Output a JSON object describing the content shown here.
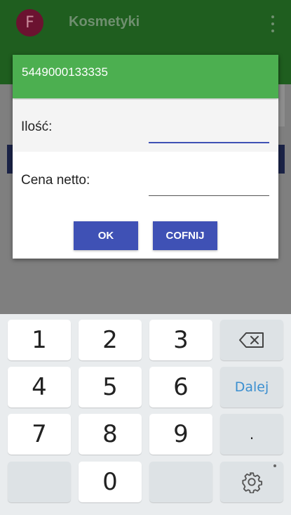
{
  "appbar": {
    "avatar_letter": "F",
    "title": "Kosmetyki",
    "menu_icon": "more-vert-icon"
  },
  "dialog": {
    "title": "5449000133335",
    "fields": [
      {
        "label": "Ilość:",
        "value": "",
        "placeholder": ""
      },
      {
        "label": "Cena netto:",
        "value": "",
        "placeholder": ""
      }
    ],
    "ok_label": "OK",
    "cancel_label": "COFNIJ"
  },
  "keyboard": {
    "keys": {
      "k1": "1",
      "k2": "2",
      "k3": "3",
      "k4": "4",
      "k5": "5",
      "k6": "6",
      "k7": "7",
      "k8": "8",
      "k9": "9",
      "k0": "0",
      "dot": ".",
      "next": "Dalej"
    },
    "backspace_icon": "backspace-icon",
    "settings_icon": "gear-icon"
  },
  "colors": {
    "appbar_green": "#1f5e1f",
    "dialog_header": "#4caf50",
    "accent_blue": "#3f51b5",
    "avatar": "#6b1230",
    "action_key_text": "#3b8fd0"
  }
}
